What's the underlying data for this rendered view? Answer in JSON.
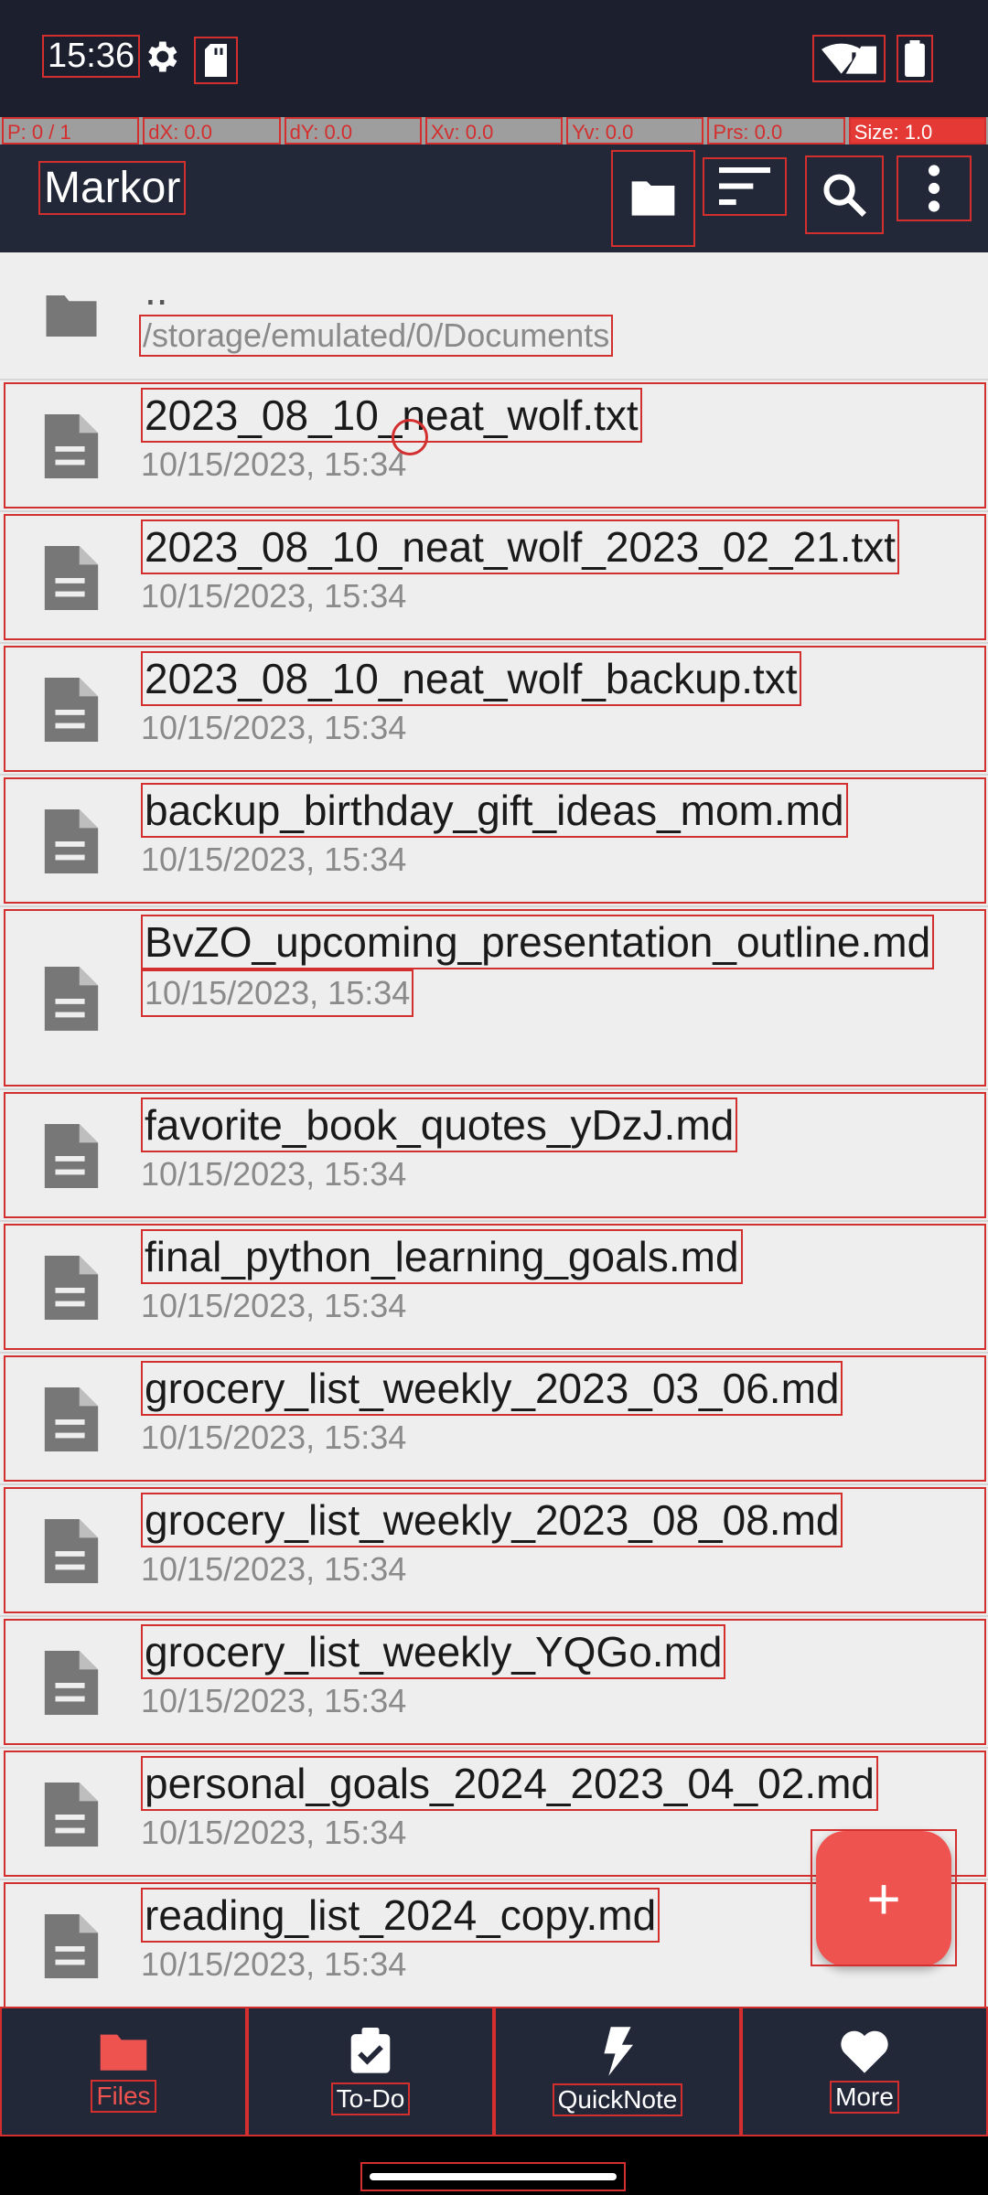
{
  "status_bar": {
    "time": "15:36",
    "icons": [
      "gear-icon",
      "sd-card-icon",
      "wifi-icon",
      "signal-icon",
      "battery-icon"
    ]
  },
  "debug_bar": {
    "p": "P: 0 / 1",
    "dx": "dX: 0.0",
    "dy": "dY: 0.0",
    "xv": "Xv: 0.0",
    "yv": "Yv: 0.0",
    "prs": "Prs: 0.0",
    "size": "Size: 1.0"
  },
  "app_bar": {
    "title": "Markor",
    "actions": [
      "folder-icon",
      "sort-icon",
      "search-icon",
      "more-vert-icon"
    ]
  },
  "file_list": {
    "parent": {
      "name": "..",
      "path": "/storage/emulated/0/Documents"
    },
    "files": [
      {
        "name": "2023_08_10_neat_wolf.txt",
        "date": "10/15/2023, 15:34"
      },
      {
        "name": "2023_08_10_neat_wolf_2023_02_21.txt",
        "date": "10/15/2023, 15:34"
      },
      {
        "name": "2023_08_10_neat_wolf_backup.txt",
        "date": "10/15/2023, 15:34"
      },
      {
        "name": "backup_birthday_gift_ideas_mom.md",
        "date": "10/15/2023, 15:34"
      },
      {
        "name": "BvZO_upcoming_presentation_outline.md",
        "date": "10/15/2023, 15:34"
      },
      {
        "name": "favorite_book_quotes_yDzJ.md",
        "date": "10/15/2023, 15:34"
      },
      {
        "name": "final_python_learning_goals.md",
        "date": "10/15/2023, 15:34"
      },
      {
        "name": "grocery_list_weekly_2023_03_06.md",
        "date": "10/15/2023, 15:34"
      },
      {
        "name": "grocery_list_weekly_2023_08_08.md",
        "date": "10/15/2023, 15:34"
      },
      {
        "name": "grocery_list_weekly_YQGo.md",
        "date": "10/15/2023, 15:34"
      },
      {
        "name": "personal_goals_2024_2023_04_02.md",
        "date": "10/15/2023, 15:34"
      },
      {
        "name": "reading_list_2024_copy.md",
        "date": "10/15/2023, 15:34"
      }
    ]
  },
  "fab": {
    "icon": "+"
  },
  "bottom_nav": {
    "items": [
      {
        "label": "Files",
        "icon": "folder-icon"
      },
      {
        "label": "To-Do",
        "icon": "checklist-icon"
      },
      {
        "label": "QuickNote",
        "icon": "bolt-icon"
      },
      {
        "label": "More",
        "icon": "heart-icon"
      }
    ]
  },
  "colors": {
    "accent": "#ef5350",
    "bar": "#232838",
    "list_bg": "#eeeeee"
  }
}
